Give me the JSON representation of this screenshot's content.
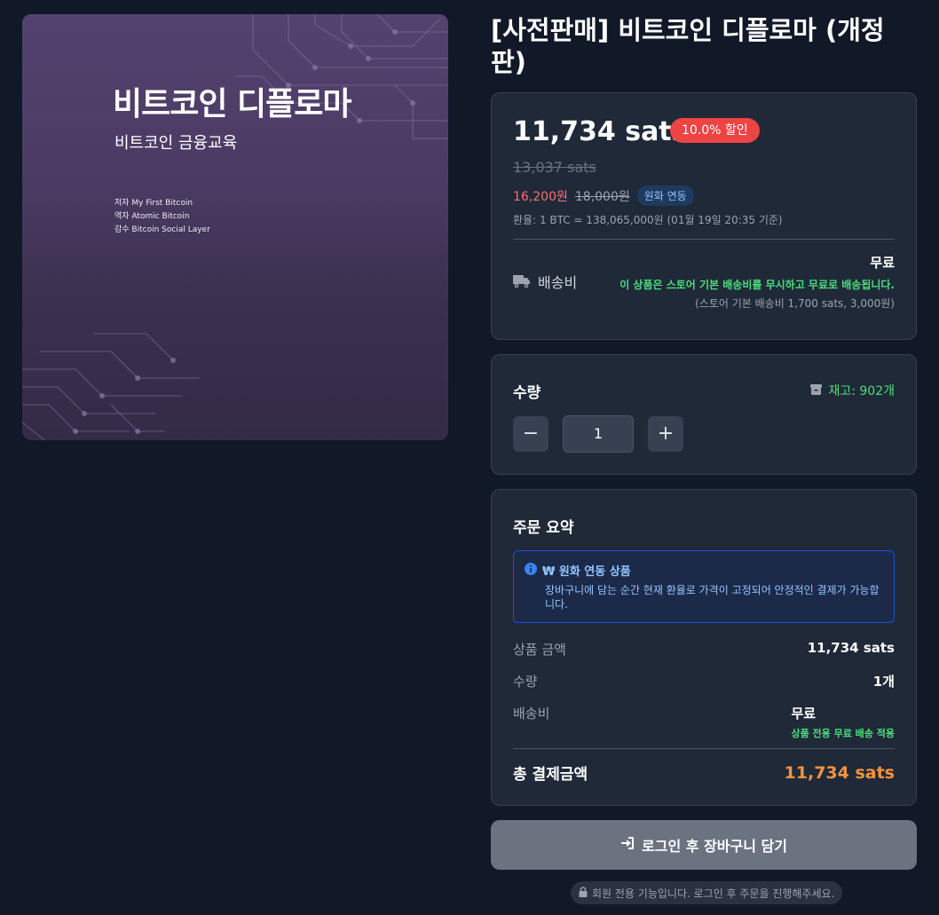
{
  "product": {
    "title": "[사전판매] 비트코인 디플로마 (개정판)"
  },
  "cover": {
    "title": "비트코인 디플로마",
    "subtitle": "비트코인 금융교육",
    "credits": [
      "저자 My First Bitcoin",
      "역자 Atomic Bitcoin",
      "감수 Bitcoin Social Layer"
    ]
  },
  "price": {
    "sats": "11,734 sats",
    "discount_badge": "10.0% 할인",
    "original_sats": "13,037 sats",
    "krw_now": "16,200원",
    "krw_original": "18,000원",
    "krw_badge": "원화 연동",
    "rate": "환율: 1 BTC = 138,065,000원 (01월 19일 20:35 기준)"
  },
  "shipping": {
    "label": "배송비",
    "value": "무료",
    "note": "이 상품은 스토어 기본 배송비를 무시하고 무료로 배송됩니다.",
    "base": "(스토어 기본 배송비 1,700 sats, 3,000원)"
  },
  "quantity": {
    "label": "수량",
    "stock": "재고: 902개",
    "value": "1",
    "minus": "−",
    "plus": "+"
  },
  "summary": {
    "title": "주문 요약",
    "info_title": "₩ 원화 연동 상품",
    "info_text": "장바구니에 담는 순간 현재 환율로 가격이 고정되어 안정적인 결제가 가능합니다.",
    "rows": [
      {
        "label": "상품 금액",
        "value": "11,734 sats"
      },
      {
        "label": "수량",
        "value": "1개"
      },
      {
        "label": "배송비",
        "value": "무료",
        "note": "상품 전용 무료 배송 적용"
      }
    ],
    "total_label": "총 결제금액",
    "total_value": "11,734 sats"
  },
  "actions": {
    "login_cart": "로그인 후 장바구니 담기",
    "member_note": "회원 전용 기능입니다. 로그인 후 주문을 진행해주세요."
  },
  "colors": {
    "background": "#111827",
    "card": "#1f2937",
    "discount": "#ef4444",
    "green": "#4ade80",
    "total": "#fb923c",
    "info_blue": "#93c5fd"
  }
}
